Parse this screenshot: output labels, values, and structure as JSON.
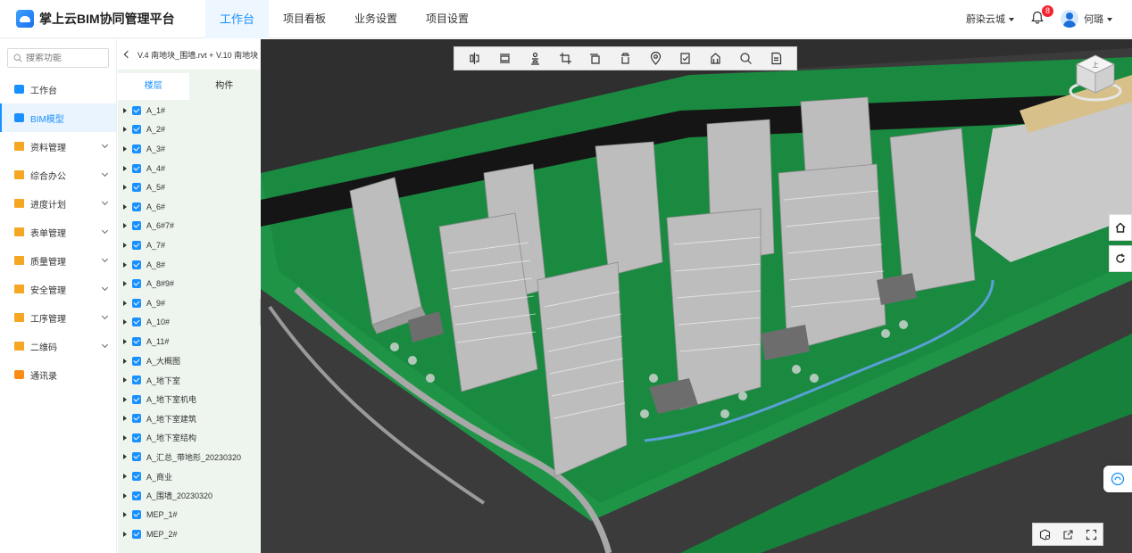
{
  "app": {
    "title": "掌上云BIM协同管理平台",
    "logo_icon": "cloud-logo-icon"
  },
  "nav": {
    "items": [
      {
        "label": "工作台",
        "active": true
      },
      {
        "label": "项目看板",
        "active": false
      },
      {
        "label": "业务设置",
        "active": false
      },
      {
        "label": "项目设置",
        "active": false
      }
    ]
  },
  "header": {
    "org": "蔚染云城",
    "notification_count": "8",
    "user_name": "何璐"
  },
  "sidebar": {
    "search_placeholder": "搜索功能",
    "items": [
      {
        "label": "工作台",
        "icon": "dashboard-icon",
        "active": false,
        "expandable": false
      },
      {
        "label": "BIM模型",
        "icon": "building-icon",
        "active": true,
        "expandable": false
      },
      {
        "label": "资料管理",
        "icon": "folder-icon",
        "active": false,
        "expandable": true
      },
      {
        "label": "综合办公",
        "icon": "folder-icon",
        "active": false,
        "expandable": true
      },
      {
        "label": "进度计划",
        "icon": "folder-icon",
        "active": false,
        "expandable": true
      },
      {
        "label": "表单管理",
        "icon": "folder-icon",
        "active": false,
        "expandable": true
      },
      {
        "label": "质量管理",
        "icon": "folder-icon",
        "active": false,
        "expandable": true
      },
      {
        "label": "安全管理",
        "icon": "folder-icon",
        "active": false,
        "expandable": true
      },
      {
        "label": "工序管理",
        "icon": "folder-icon",
        "active": false,
        "expandable": true
      },
      {
        "label": "二维码",
        "icon": "folder-icon",
        "active": false,
        "expandable": true
      },
      {
        "label": "通讯录",
        "icon": "contacts-icon",
        "active": false,
        "expandable": false
      }
    ]
  },
  "tree": {
    "file_path": "V.4 南地块_围墙.rvt + V.10 南地块",
    "tabs": [
      {
        "label": "楼层",
        "active": true
      },
      {
        "label": "构件",
        "active": false
      }
    ],
    "nodes": [
      "A_1#",
      "A_2#",
      "A_3#",
      "A_4#",
      "A_5#",
      "A_6#",
      "A_6#7#",
      "A_7#",
      "A_8#",
      "A_8#9#",
      "A_9#",
      "A_10#",
      "A_11#",
      "A_大概图",
      "A_地下室",
      "A_地下室机电",
      "A_地下室建筑",
      "A_地下室结构",
      "A_汇总_带地形_20230320",
      "A_商业",
      "A_围墙_20230320",
      "MEP_1#",
      "MEP_2#"
    ]
  },
  "viewer": {
    "tools": [
      "section-icon",
      "section-box-icon",
      "roam-icon",
      "crop-icon",
      "layers-icon",
      "delete-icon",
      "location-icon",
      "checklist-icon",
      "explode-icon",
      "search-icon",
      "document-icon"
    ],
    "navcube_label": "上",
    "side_buttons": [
      "home-icon",
      "reset-icon"
    ],
    "bottom_tools": [
      "model-settings-icon",
      "open-external-icon",
      "fullscreen-icon"
    ],
    "colors": {
      "ground": "#16813b",
      "road": "#3a3a3a",
      "building": "#bdbdbd",
      "water": "#5aa0d6"
    }
  }
}
